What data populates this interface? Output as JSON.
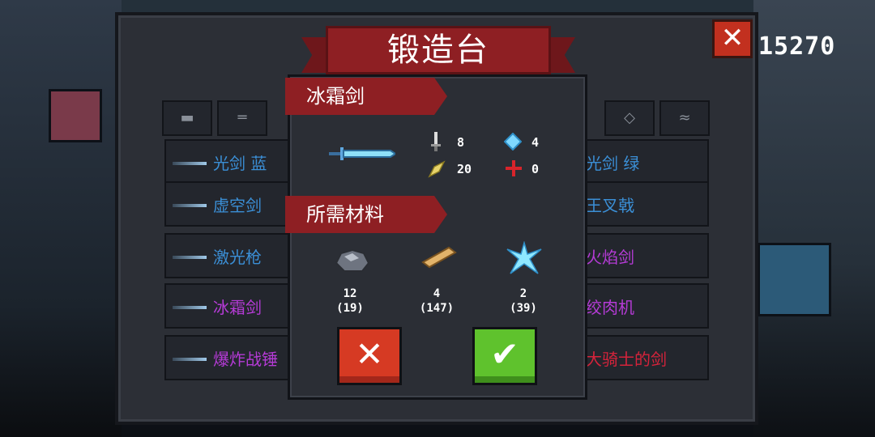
{
  "title": "锻造台",
  "coins": "15270",
  "close_icon": "close-icon",
  "tabs": [
    {
      "icon": "pistol-icon",
      "glyph": "▬"
    },
    {
      "icon": "rifle-icon",
      "glyph": "═"
    },
    {
      "icon": "diamond-icon",
      "glyph": "◇"
    },
    {
      "icon": "fish-icon",
      "glyph": "≈"
    }
  ],
  "list": {
    "left": [
      {
        "name": "光剑 蓝",
        "color": "#3b8fd6"
      },
      {
        "name": "虚空剑",
        "color": "#3b8fd6"
      },
      {
        "name": "激光枪",
        "color": "#3b8fd6"
      },
      {
        "name": "冰霜剑",
        "color": "#b53bd6"
      },
      {
        "name": "爆炸战锤",
        "color": "#b53bd6"
      }
    ],
    "right": [
      {
        "name": "光剑 绿",
        "color": "#3b8fd6"
      },
      {
        "name": "王叉戟",
        "color": "#3b8fd6"
      },
      {
        "name": "火焰剑",
        "color": "#b53bd6"
      },
      {
        "name": "绞肉机",
        "color": "#b53bd6"
      },
      {
        "name": "大骑士的剑",
        "color": "#d6233b"
      }
    ]
  },
  "dialog": {
    "weapon_name": "冰霜剑",
    "stats": {
      "damage": "8",
      "energy": "4",
      "crit": "20",
      "accuracy": "0"
    },
    "materials_title": "所需材料",
    "materials": [
      {
        "icon": "ore-icon",
        "need": "12",
        "have": "(19)"
      },
      {
        "icon": "wood-icon",
        "need": "4",
        "have": "(147)"
      },
      {
        "icon": "ice-crystal-icon",
        "need": "2",
        "have": "(39)"
      }
    ],
    "cancel_icon": "x-icon",
    "confirm_icon": "check-icon"
  }
}
